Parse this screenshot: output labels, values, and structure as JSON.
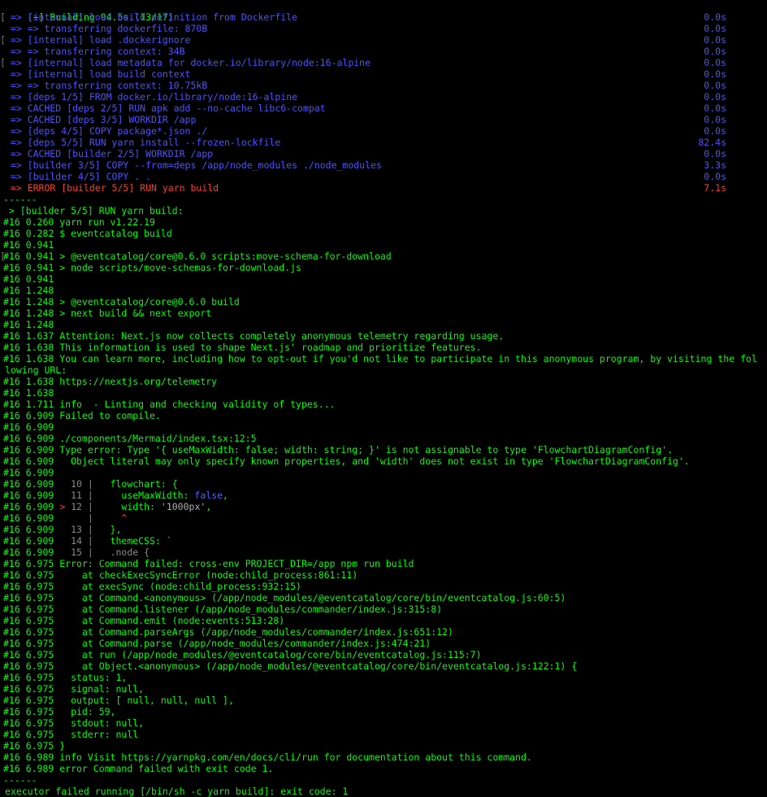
{
  "colors": {
    "header": "#00ff00",
    "step": "#5050ff",
    "error": "#ff3b30",
    "log": "#00ff00",
    "dim": "#8a8a8a",
    "caret": "#ff3b30",
    "key": "#00ff00",
    "bool": "#5a5aff",
    "string": "#b0b0b0",
    "background": "#000000"
  },
  "header": "[+] Building 94.5s (13/17)",
  "steps": [
    {
      "gutter": "[",
      "text": " => [internal] load build definition from Dockerfile",
      "time": "0.0s",
      "kind": "step"
    },
    {
      "gutter": "",
      "text": " => => transferring dockerfile: 870B",
      "time": "0.0s",
      "kind": "step"
    },
    {
      "gutter": "[",
      "text": " => [internal] load .dockerignore",
      "time": "0.0s",
      "kind": "step"
    },
    {
      "gutter": "",
      "text": " => => transferring context: 34B",
      "time": "0.0s",
      "kind": "step"
    },
    {
      "gutter": "[",
      "text": " => [internal] load metadata for docker.io/library/node:16-alpine",
      "time": "0.0s",
      "kind": "step"
    },
    {
      "gutter": "",
      "text": " => [internal] load build context",
      "time": "0.0s",
      "kind": "step"
    },
    {
      "gutter": "",
      "text": " => => transferring context: 10.75kB",
      "time": "0.0s",
      "kind": "step"
    },
    {
      "gutter": "",
      "text": " => [deps 1/5] FROM docker.io/library/node:16-alpine",
      "time": "0.0s",
      "kind": "step"
    },
    {
      "gutter": "",
      "text": " => CACHED [deps 2/5] RUN apk add --no-cache libc6-compat",
      "time": "0.0s",
      "kind": "step"
    },
    {
      "gutter": "",
      "text": " => CACHED [deps 3/5] WORKDIR /app",
      "time": "0.0s",
      "kind": "step"
    },
    {
      "gutter": "",
      "text": " => [deps 4/5] COPY package*.json ./",
      "time": "0.0s",
      "kind": "step"
    },
    {
      "gutter": "",
      "text": " => [deps 5/5] RUN yarn install --frozen-lockfile",
      "time": "82.4s",
      "kind": "step"
    },
    {
      "gutter": "",
      "text": " => CACHED [builder 2/5] WORKDIR /app",
      "time": "0.0s",
      "kind": "step"
    },
    {
      "gutter": "",
      "text": " => [builder 3/5] COPY --from=deps /app/node_modules ./node_modules",
      "time": "3.3s",
      "kind": "step"
    },
    {
      "gutter": "",
      "text": " => [builder 4/5] COPY . .",
      "time": "0.0s",
      "kind": "step"
    },
    {
      "gutter": "",
      "text": " => ERROR [builder 5/5] RUN yarn build",
      "time": "7.1s",
      "kind": "error"
    }
  ],
  "log": [
    {
      "gutter": "",
      "segs": [
        {
          "t": "------",
          "c": "log"
        }
      ]
    },
    {
      "gutter": "",
      "segs": [
        {
          "t": " > [builder 5/5] RUN yarn build:",
          "c": "log"
        }
      ]
    },
    {
      "gutter": "",
      "segs": [
        {
          "t": "#16 0.260 yarn run v1.22.19",
          "c": "log"
        }
      ]
    },
    {
      "gutter": "",
      "segs": [
        {
          "t": "#16 0.282 $ eventcatalog build",
          "c": "log"
        }
      ]
    },
    {
      "gutter": "",
      "segs": [
        {
          "t": "#16 0.941",
          "c": "log"
        }
      ]
    },
    {
      "gutter": "[",
      "segs": [
        {
          "t": "#16 0.941 > @eventcatalog/core@0.6.0 scripts:move-schema-for-download",
          "c": "log"
        }
      ]
    },
    {
      "gutter": "",
      "segs": [
        {
          "t": "#16 0.941 > node scripts/move-schemas-for-download.js",
          "c": "log"
        }
      ]
    },
    {
      "gutter": "",
      "segs": [
        {
          "t": "#16 0.941",
          "c": "log"
        }
      ]
    },
    {
      "gutter": "",
      "segs": [
        {
          "t": "#16 1.248",
          "c": "log"
        }
      ]
    },
    {
      "gutter": "",
      "segs": [
        {
          "t": "#16 1.248 > @eventcatalog/core@0.6.0 build",
          "c": "log"
        }
      ]
    },
    {
      "gutter": "",
      "segs": [
        {
          "t": "#16 1.248 > next build && next export",
          "c": "log"
        }
      ]
    },
    {
      "gutter": "",
      "segs": [
        {
          "t": "#16 1.248",
          "c": "log"
        }
      ]
    },
    {
      "gutter": "",
      "segs": [
        {
          "t": "#16 1.637 Attention: Next.js now collects completely anonymous telemetry regarding usage.",
          "c": "log"
        }
      ]
    },
    {
      "gutter": "",
      "segs": [
        {
          "t": "#16 1.638 This information is used to shape Next.js' roadmap and prioritize features.",
          "c": "log"
        }
      ]
    },
    {
      "gutter": "",
      "segs": [
        {
          "t": "#16 1.638 You can learn more, including how to opt-out if you'd not like to participate in this anonymous program, by visiting the fol",
          "c": "log"
        }
      ]
    },
    {
      "gutter": "",
      "segs": [
        {
          "t": "lowing URL:",
          "c": "log"
        }
      ],
      "flush": true
    },
    {
      "gutter": "",
      "segs": [
        {
          "t": "#16 1.638 https://nextjs.org/telemetry",
          "c": "log"
        }
      ]
    },
    {
      "gutter": "",
      "segs": [
        {
          "t": "#16 1.638",
          "c": "log"
        }
      ]
    },
    {
      "gutter": "",
      "segs": [
        {
          "t": "#16 1.711 info  - Linting and checking validity of types...",
          "c": "log"
        }
      ]
    },
    {
      "gutter": "",
      "segs": [
        {
          "t": "#16 6.909 Failed to compile.",
          "c": "log"
        }
      ]
    },
    {
      "gutter": "",
      "segs": [
        {
          "t": "#16 6.909",
          "c": "log"
        }
      ]
    },
    {
      "gutter": "",
      "segs": [
        {
          "t": "#16 6.909 ./components/Mermaid/index.tsx:12:5",
          "c": "log"
        }
      ]
    },
    {
      "gutter": "",
      "segs": [
        {
          "t": "#16 6.909 Type error: Type '{ useMaxWidth: false; width: string; }' is not assignable to type 'FlowchartDiagramConfig'.",
          "c": "log"
        }
      ]
    },
    {
      "gutter": "",
      "segs": [
        {
          "t": "#16 6.909   Object literal may only specify known properties, and 'width' does not exist in type 'FlowchartDiagramConfig'.",
          "c": "log"
        }
      ]
    },
    {
      "gutter": "",
      "segs": [
        {
          "t": "#16 6.909",
          "c": "log"
        }
      ]
    },
    {
      "gutter": "",
      "segs": [
        {
          "t": "#16 6.909 ",
          "c": "log"
        },
        {
          "t": "  10 |",
          "c": "dim"
        },
        {
          "t": "   flowchart: {",
          "c": "key"
        }
      ]
    },
    {
      "gutter": "",
      "segs": [
        {
          "t": "#16 6.909 ",
          "c": "log"
        },
        {
          "t": "  11 |",
          "c": "dim"
        },
        {
          "t": "     useMaxWidth: ",
          "c": "key"
        },
        {
          "t": "false",
          "c": "bool"
        },
        {
          "t": ",",
          "c": "key"
        }
      ]
    },
    {
      "gutter": "",
      "segs": [
        {
          "t": "#16 6.909 ",
          "c": "log"
        },
        {
          "t": "> ",
          "c": "caret"
        },
        {
          "t": "12 |",
          "c": "dim"
        },
        {
          "t": "     width: ",
          "c": "key"
        },
        {
          "t": "'1000px'",
          "c": "string"
        },
        {
          "t": ",",
          "c": "key"
        }
      ]
    },
    {
      "gutter": "",
      "segs": [
        {
          "t": "#16 6.909 ",
          "c": "log"
        },
        {
          "t": "     |",
          "c": "dim"
        },
        {
          "t": "     ^",
          "c": "caret"
        }
      ]
    },
    {
      "gutter": "",
      "segs": [
        {
          "t": "#16 6.909 ",
          "c": "log"
        },
        {
          "t": "  13 |",
          "c": "dim"
        },
        {
          "t": "   },",
          "c": "key"
        }
      ]
    },
    {
      "gutter": "",
      "segs": [
        {
          "t": "#16 6.909 ",
          "c": "log"
        },
        {
          "t": "  14 |",
          "c": "dim"
        },
        {
          "t": "   themeCSS: `",
          "c": "key"
        }
      ]
    },
    {
      "gutter": "",
      "segs": [
        {
          "t": "#16 6.909 ",
          "c": "log"
        },
        {
          "t": "  15 |",
          "c": "dim"
        },
        {
          "t": "   .node {",
          "c": "dim"
        }
      ]
    },
    {
      "gutter": "",
      "segs": [
        {
          "t": "#16 6.975 Error: Command failed: cross-env PROJECT_DIR=/app npm run build",
          "c": "log"
        }
      ]
    },
    {
      "gutter": "",
      "segs": [
        {
          "t": "#16 6.975     at checkExecSyncError (node:child_process:861:11)",
          "c": "log"
        }
      ]
    },
    {
      "gutter": "",
      "segs": [
        {
          "t": "#16 6.975     at execSync (node:child_process:932:15)",
          "c": "log"
        }
      ]
    },
    {
      "gutter": "",
      "segs": [
        {
          "t": "#16 6.975     at Command.<anonymous> (/app/node_modules/@eventcatalog/core/bin/eventcatalog.js:60:5)",
          "c": "log"
        }
      ]
    },
    {
      "gutter": "",
      "segs": [
        {
          "t": "#16 6.975     at Command.listener (/app/node_modules/commander/index.js:315:8)",
          "c": "log"
        }
      ]
    },
    {
      "gutter": "",
      "segs": [
        {
          "t": "#16 6.975     at Command.emit (node:events:513:28)",
          "c": "log"
        }
      ]
    },
    {
      "gutter": "",
      "segs": [
        {
          "t": "#16 6.975     at Command.parseArgs (/app/node_modules/commander/index.js:651:12)",
          "c": "log"
        }
      ]
    },
    {
      "gutter": "",
      "segs": [
        {
          "t": "#16 6.975     at Command.parse (/app/node_modules/commander/index.js:474:21)",
          "c": "log"
        }
      ]
    },
    {
      "gutter": "",
      "segs": [
        {
          "t": "#16 6.975     at run (/app/node_modules/@eventcatalog/core/bin/eventcatalog.js:115:7)",
          "c": "log"
        }
      ]
    },
    {
      "gutter": "",
      "segs": [
        {
          "t": "#16 6.975     at Object.<anonymous> (/app/node_modules/@eventcatalog/core/bin/eventcatalog.js:122:1) {",
          "c": "log"
        }
      ]
    },
    {
      "gutter": "",
      "segs": [
        {
          "t": "#16 6.975   status: 1,",
          "c": "log"
        }
      ]
    },
    {
      "gutter": "",
      "segs": [
        {
          "t": "#16 6.975   signal: null,",
          "c": "log"
        }
      ]
    },
    {
      "gutter": "",
      "segs": [
        {
          "t": "#16 6.975   output: [ null, null, null ],",
          "c": "log"
        }
      ]
    },
    {
      "gutter": "",
      "segs": [
        {
          "t": "#16 6.975   pid: 59,",
          "c": "log"
        }
      ]
    },
    {
      "gutter": "",
      "segs": [
        {
          "t": "#16 6.975   stdout: null,",
          "c": "log"
        }
      ]
    },
    {
      "gutter": "",
      "segs": [
        {
          "t": "#16 6.975   stderr: null",
          "c": "log"
        }
      ]
    },
    {
      "gutter": "",
      "segs": [
        {
          "t": "#16 6.975 }",
          "c": "log"
        }
      ]
    },
    {
      "gutter": "",
      "segs": [
        {
          "t": "#16 6.989 info Visit https://yarnpkg.com/en/docs/cli/run for documentation about this command.",
          "c": "log"
        }
      ]
    },
    {
      "gutter": "",
      "segs": [
        {
          "t": "#16 6.989 error Command failed with exit code 1.",
          "c": "log"
        }
      ]
    },
    {
      "gutter": "",
      "segs": [
        {
          "t": "------",
          "c": "log"
        }
      ]
    },
    {
      "gutter": "",
      "segs": [
        {
          "t": "executor failed running [/bin/sh -c yarn build]: exit code: 1",
          "c": "log"
        }
      ],
      "flush": true
    }
  ]
}
